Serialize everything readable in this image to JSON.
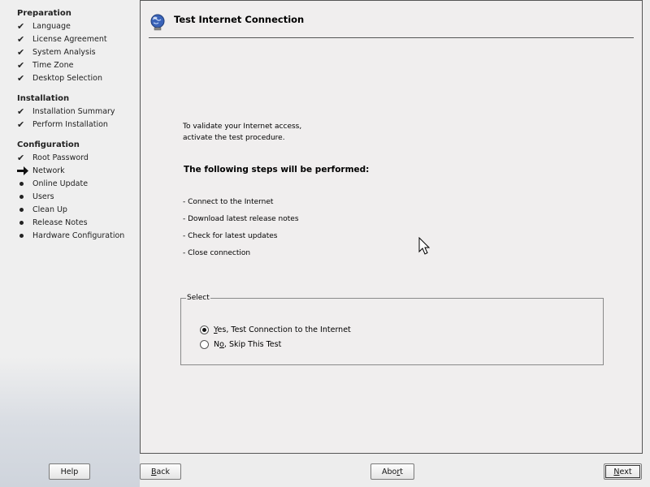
{
  "sidebar": {
    "sections": [
      {
        "title": "Preparation",
        "items": [
          {
            "label": "Language",
            "state": "done"
          },
          {
            "label": "License Agreement",
            "state": "done"
          },
          {
            "label": "System Analysis",
            "state": "done"
          },
          {
            "label": "Time Zone",
            "state": "done"
          },
          {
            "label": "Desktop Selection",
            "state": "done"
          }
        ]
      },
      {
        "title": "Installation",
        "items": [
          {
            "label": "Installation Summary",
            "state": "done"
          },
          {
            "label": "Perform Installation",
            "state": "done"
          }
        ]
      },
      {
        "title": "Configuration",
        "items": [
          {
            "label": "Root Password",
            "state": "done"
          },
          {
            "label": "Network",
            "state": "current"
          },
          {
            "label": "Online Update",
            "state": "pending"
          },
          {
            "label": "Users",
            "state": "pending"
          },
          {
            "label": "Clean Up",
            "state": "pending"
          },
          {
            "label": "Release Notes",
            "state": "pending"
          },
          {
            "label": "Hardware Configuration",
            "state": "pending"
          }
        ]
      }
    ]
  },
  "header": {
    "title": "Test Internet Connection",
    "icon": "globe-network-icon"
  },
  "content": {
    "intro_line1": "To validate your Internet access,",
    "intro_line2": "activate the test procedure.",
    "steps_title": "The following steps will be performed:",
    "steps": [
      "- Connect to the Internet",
      "- Download latest release notes",
      "- Check for latest updates",
      "- Close connection"
    ]
  },
  "select_group": {
    "legend": "Select",
    "options": [
      {
        "mnemonic": "Y",
        "rest": "es, Test Connection to the Internet",
        "selected": true
      },
      {
        "mnemonic_pre": "N",
        "mnemonic": "o",
        "rest": ", Skip This Test",
        "selected": false
      }
    ]
  },
  "buttons": {
    "help": "Help",
    "back_mn": "B",
    "back_rest": "ack",
    "abort_pre": "Abo",
    "abort_mn": "r",
    "abort_rest": "t",
    "next_mn": "N",
    "next_rest": "ext"
  }
}
